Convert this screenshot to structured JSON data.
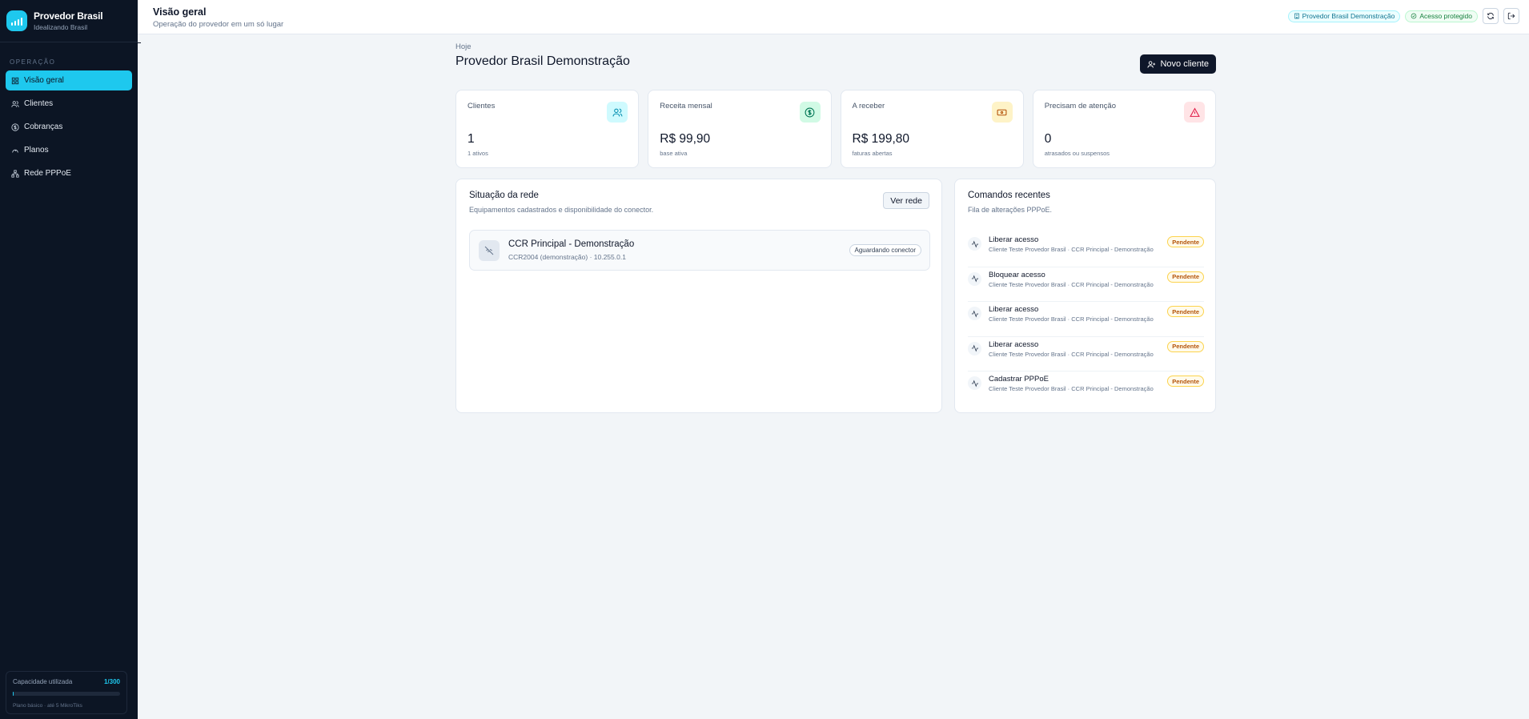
{
  "brand": {
    "title": "Provedor Brasil",
    "subtitle": "Idealizando Brasil"
  },
  "sidebar": {
    "section_label": "OPERAÇÃO",
    "items": [
      {
        "label": "Visão geral",
        "icon": "grid-icon",
        "active": true
      },
      {
        "label": "Clientes",
        "icon": "users-icon"
      },
      {
        "label": "Cobranças",
        "icon": "dollar-circle-icon"
      },
      {
        "label": "Planos",
        "icon": "gauge-icon"
      },
      {
        "label": "Rede PPPoE",
        "icon": "network-icon"
      }
    ],
    "capacity": {
      "label": "Capacidade utilizada",
      "value": "1/300",
      "used": 1,
      "total": 300,
      "note": "Plano básico · até 5 MikroTiks"
    }
  },
  "topbar": {
    "title": "Visão geral",
    "subtitle": "Operação do provedor em um só lugar",
    "tenant_pill": "Provedor Brasil Demonstração",
    "security_pill": "Acesso protegido"
  },
  "main": {
    "eyebrow": "Hoje",
    "title": "Provedor Brasil Demonstração",
    "new_client_label": "Novo cliente"
  },
  "stats": [
    {
      "label": "Clientes",
      "value": "1",
      "note": "1 ativos",
      "icon": "users-icon",
      "bg": "#cffafe",
      "fg": "#0891b2"
    },
    {
      "label": "Receita mensal",
      "value": "R$ 99,90",
      "note": "base ativa",
      "icon": "dollar-circle-icon",
      "bg": "#d1fae5",
      "fg": "#047857"
    },
    {
      "label": "A receber",
      "value": "R$ 199,80",
      "note": "faturas abertas",
      "icon": "banknote-icon",
      "bg": "#fef3c7",
      "fg": "#b45309"
    },
    {
      "label": "Precisam de atenção",
      "value": "0",
      "note": "atrasados ou suspensos",
      "icon": "alert-triangle-icon",
      "bg": "#ffe4e6",
      "fg": "#e11d48"
    }
  ],
  "network": {
    "title": "Situação da rede",
    "subtitle": "Equipamentos cadastrados e disponibilidade do conector.",
    "view_button": "Ver rede",
    "devices": [
      {
        "name": "CCR Principal - Demonstração",
        "meta": "CCR2004 (demonstração) · 10.255.0.1",
        "status": "Aguardando conector",
        "icon": "wifi-off-icon"
      }
    ]
  },
  "commands": {
    "title": "Comandos recentes",
    "subtitle": "Fila de alterações PPPoE.",
    "items": [
      {
        "name": "Liberar acesso",
        "detail": "Cliente Teste Provedor Brasil · CCR Principal - Demonstração",
        "status": "Pendente"
      },
      {
        "name": "Bloquear acesso",
        "detail": "Cliente Teste Provedor Brasil · CCR Principal - Demonstração",
        "status": "Pendente"
      },
      {
        "name": "Liberar acesso",
        "detail": "Cliente Teste Provedor Brasil · CCR Principal - Demonstração",
        "status": "Pendente"
      },
      {
        "name": "Liberar acesso",
        "detail": "Cliente Teste Provedor Brasil · CCR Principal - Demonstração",
        "status": "Pendente"
      },
      {
        "name": "Cadastrar PPPoE",
        "detail": "Cliente Teste Provedor Brasil · CCR Principal - Demonstração",
        "status": "Pendente"
      }
    ]
  },
  "colors": {
    "accent": "#1ec8ee",
    "sidebar_bg": "#0c1524",
    "pending": "#b45309"
  }
}
